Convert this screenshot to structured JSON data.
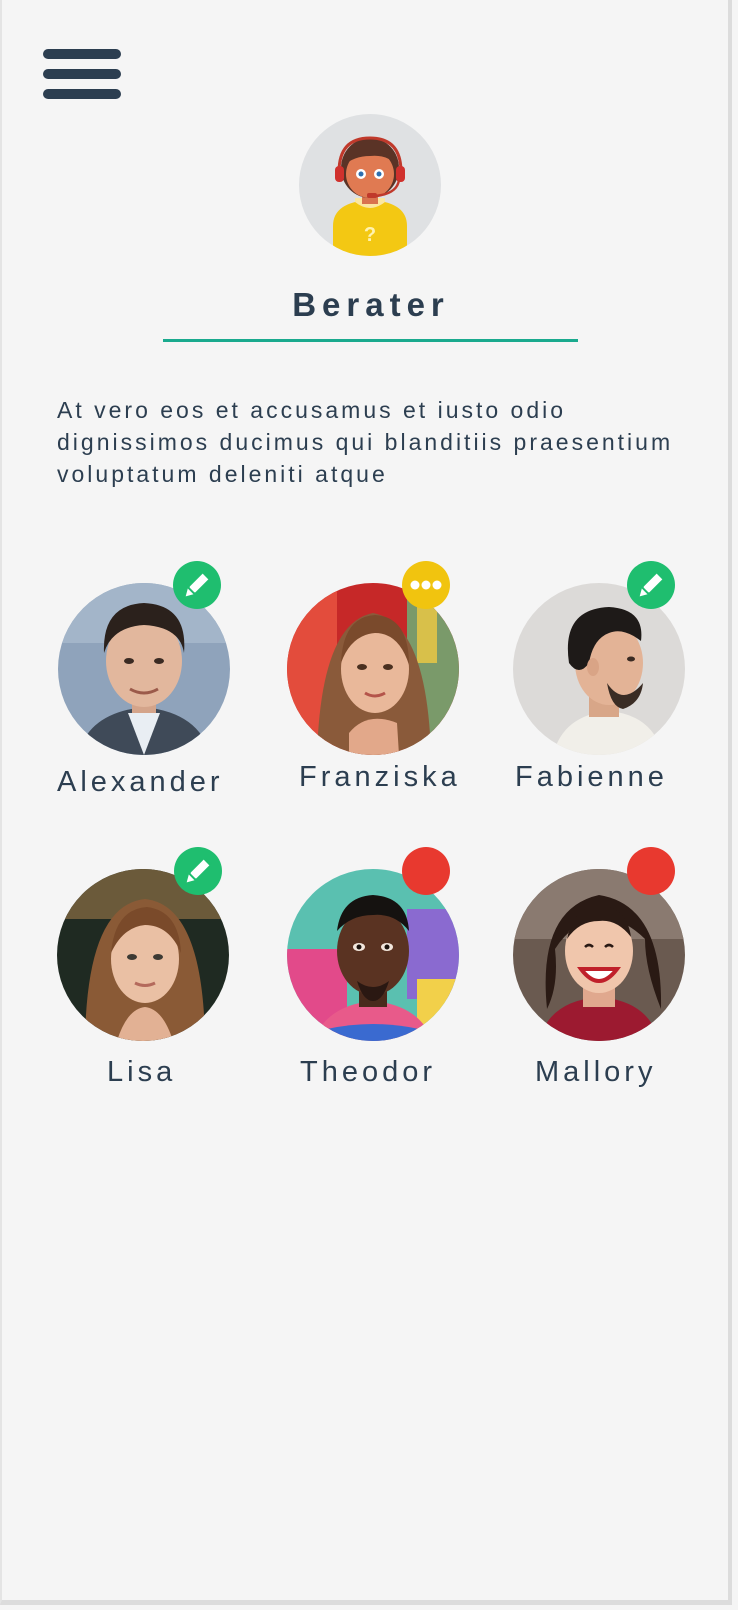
{
  "menu": {
    "icon": "hamburger-menu-icon"
  },
  "header": {
    "avatar_icon": "support-agent-icon",
    "title": "Berater",
    "accent_color": "#1aaa8e"
  },
  "description": "At vero eos et accusamus et iusto odio dignissimos ducimus qui blanditiis praesentium voluptatum deleniti atque",
  "people": [
    {
      "name": "Alexander",
      "status": "edit",
      "status_icon": "pencil-icon",
      "status_color": "#1fbe6f"
    },
    {
      "name": "Franziska",
      "status": "typing",
      "status_icon": "ellipsis-icon",
      "status_color": "#f1c40f"
    },
    {
      "name": "Fabienne",
      "status": "edit",
      "status_icon": "pencil-icon",
      "status_color": "#1fbe6f"
    },
    {
      "name": "Lisa",
      "status": "edit",
      "status_icon": "pencil-icon",
      "status_color": "#1fbe6f"
    },
    {
      "name": "Theodor",
      "status": "busy",
      "status_icon": "red-dot-icon",
      "status_color": "#e8392f"
    },
    {
      "name": "Mallory",
      "status": "busy",
      "status_icon": "red-dot-icon",
      "status_color": "#e8392f"
    }
  ]
}
